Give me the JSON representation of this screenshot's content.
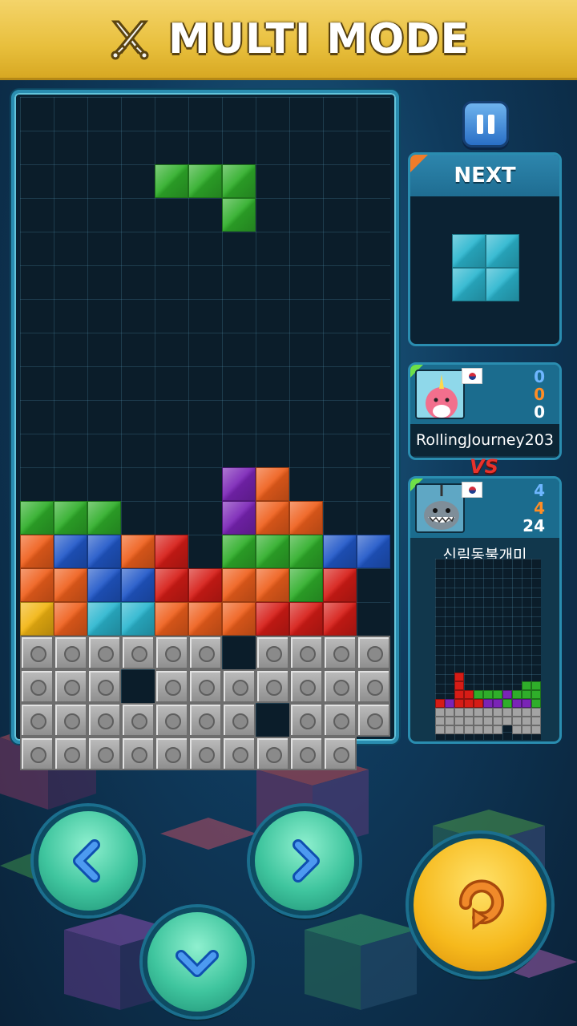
{
  "header": {
    "title": "MULTI MODE",
    "icon": "crossed-swords-icon"
  },
  "colors": {
    "green": "#2fae2a",
    "orange": "#ef5f1c",
    "blue": "#2057c8",
    "red": "#d61c16",
    "purple": "#7a24b6",
    "cyan": "#2bb6cf",
    "yellow": "#f2b511"
  },
  "next": {
    "label": "NEXT",
    "piece": "O",
    "color": "#2bb6cf"
  },
  "player": {
    "name": "RollingJourney203",
    "stats": [
      "0",
      "0",
      "0"
    ],
    "avatar": "narwhal-avatar",
    "flag": "korea-flag"
  },
  "vs_label": "VS",
  "opponent": {
    "name": "신림동불개미",
    "stats": [
      "4",
      "4",
      "24"
    ],
    "avatar": "shark-avatar",
    "flag": "korea-flag"
  },
  "board": {
    "active_piece": {
      "type": "J",
      "color": "green"
    },
    "rows": [
      ". . . . . . . . . . .",
      ". . . . . . . . . . .",
      ". . . . G G G . . . .",
      ". . . . . . G . . . .",
      ". . . . . . . . . . .",
      ". . . . . . . . . . .",
      ". . . . . . . . . . .",
      ". . . . . . . . . . .",
      ". . . . . . . . . . .",
      ". . . . . . . . . . .",
      ". . . . . . . . . . .",
      ". . . . . . P O . . .",
      "G G G . . . P O O . .",
      "O B B O R . G G G B B",
      "O O B B R R O O G R .",
      "Y O C C O O O R R R .",
      "X X X X X X . X X X X",
      "X X X . X X X X X X X",
      "X X X X X X X . X X X",
      "X X X X X X X X X X ."
    ]
  },
  "controls": [
    "left-arrow-button",
    "down-arrow-button",
    "right-arrow-button",
    "rotate-button"
  ]
}
